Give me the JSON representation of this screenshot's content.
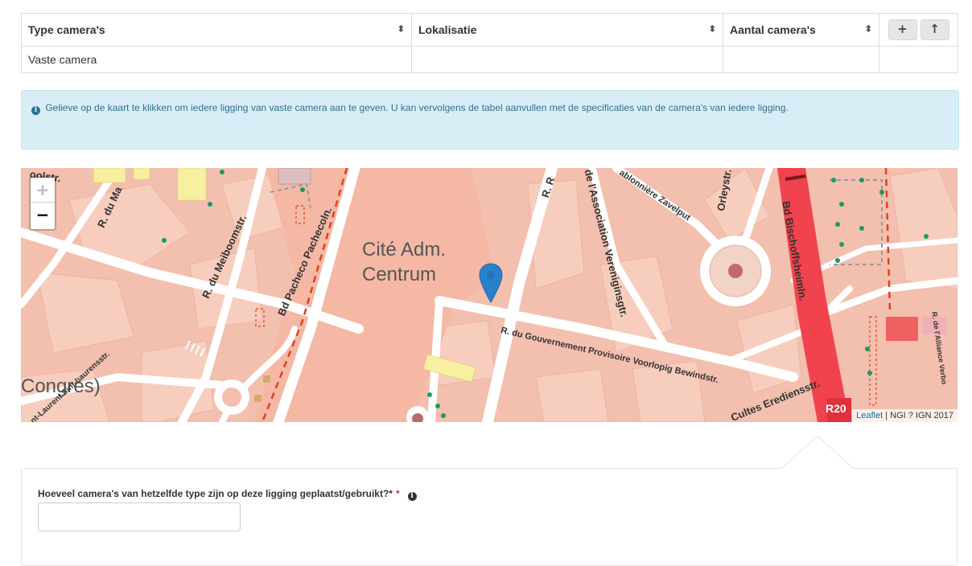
{
  "table": {
    "columns": [
      "Type camera's",
      "Lokalisatie",
      "Aantal camera's"
    ],
    "sort_icon": "sort-icon",
    "add_icon": "+",
    "up_icon": "↑",
    "rows": [
      {
        "type": "Vaste camera",
        "lokalisatie": "",
        "aantal": ""
      }
    ]
  },
  "alert": {
    "icon": "i",
    "text": "Gelieve op de kaart te klikken om iedere ligging van vaste camera aan te geven. U kan vervolgens de tabel aanvullen met de specificaties van de camera's van iedere ligging."
  },
  "map": {
    "labels": {
      "district_1": "Cité Adm.",
      "district_2": "Centrum",
      "congres": "Congrès)",
      "meiboom": "R. du Meiboomstr.",
      "pacheco": "Bd Pacheco Pachecoln.",
      "association": "de l'Association Vereniginsgtr.",
      "gouvernement": "R. du Gouvernement Provisoire Voorlopig Bewindstr.",
      "bischoffsheim": "Bd Bischoffsheimln.",
      "cultes": "Cultes Erediensstr.",
      "sablonniere": "ablonnière Zavelput",
      "orley": "Orleystr.",
      "laurent": "nt-Laurent Sint-Laurensstr.",
      "alliance": "R. de l'Alliance Verbo",
      "ruelle": "R. du Ma",
      "oolstr": "oolstr.",
      "r_top": "R. R",
      "r20": "R20"
    },
    "zoom_in": "+",
    "zoom_out": "−",
    "attribution_link": "Leaflet",
    "attribution_text": " | NGI ? IGN 2017"
  },
  "form": {
    "question": "Hoeveel camera's van hetzelfde type zijn op deze ligging geplaatst/gebruikt?*",
    "required_mark": "*",
    "info_icon": "i",
    "input_value": ""
  },
  "colors": {
    "alert_bg": "#d9edf7",
    "alert_text": "#31708f",
    "map_building": "#f3bfae",
    "map_street": "#ffffff",
    "marker": "#2a81cb",
    "ring_road": "#f0434e"
  }
}
